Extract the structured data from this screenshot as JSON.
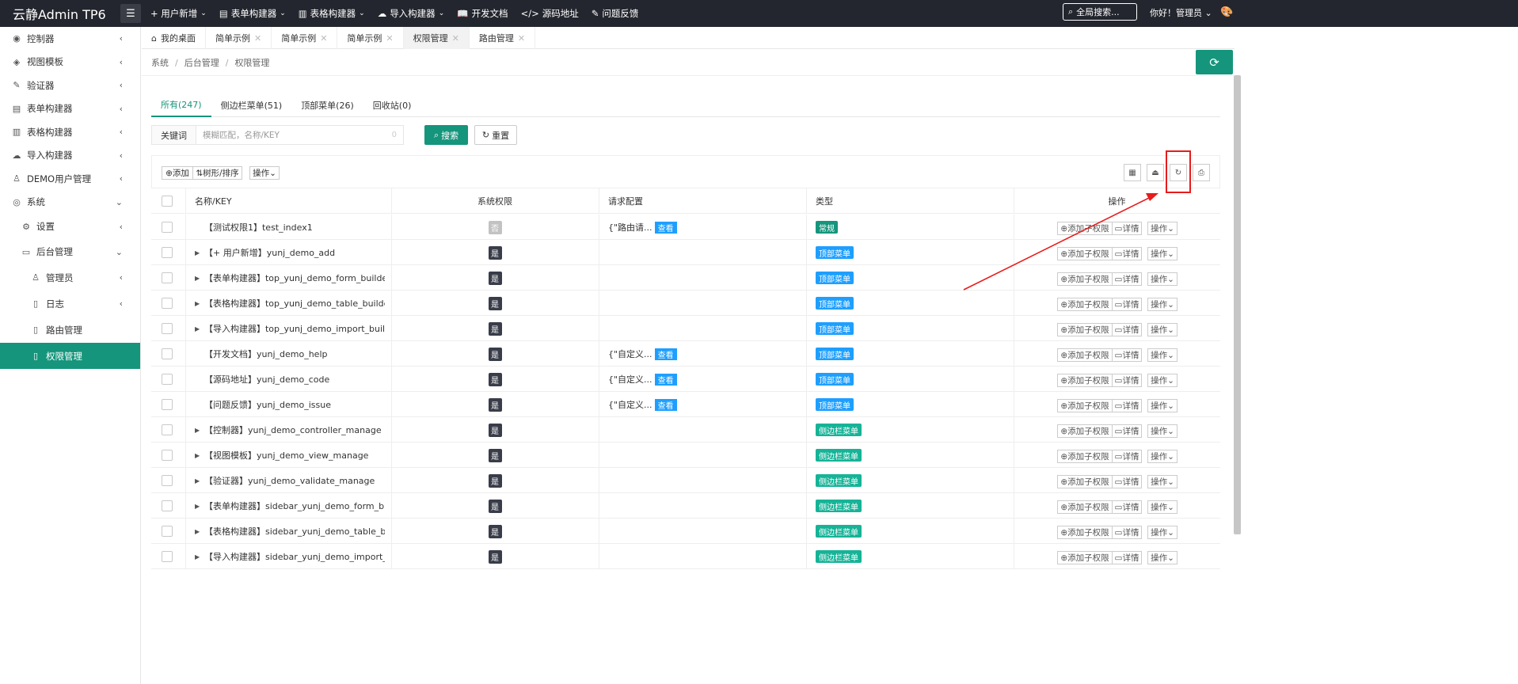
{
  "app": {
    "title": "云静Admin TP6"
  },
  "topnav": [
    {
      "label": "+ 用户新增",
      "icon": "",
      "dropdown": true
    },
    {
      "label": "表单构建器",
      "icon": "form-icon",
      "dropdown": true
    },
    {
      "label": "表格构建器",
      "icon": "table-icon",
      "dropdown": true
    },
    {
      "label": "导入构建器",
      "icon": "cloud-upload-icon",
      "dropdown": true
    },
    {
      "label": "开发文档",
      "icon": "book-icon",
      "dropdown": false
    },
    {
      "label": "源码地址",
      "icon": "code-icon",
      "dropdown": false
    },
    {
      "label": "问题反馈",
      "icon": "feedback-icon",
      "dropdown": false
    }
  ],
  "header": {
    "search_label": "全局搜索...",
    "user_label": "你好！管理员"
  },
  "sidebar": {
    "items": [
      {
        "label": "控制器",
        "icon": "dashboard-icon",
        "arrow": "‹"
      },
      {
        "label": "视图模板",
        "icon": "layers-icon",
        "arrow": "‹"
      },
      {
        "label": "验证器",
        "icon": "edit-icon",
        "arrow": "‹"
      },
      {
        "label": "表单构建器",
        "icon": "form-icon",
        "arrow": "‹"
      },
      {
        "label": "表格构建器",
        "icon": "table-icon",
        "arrow": "‹"
      },
      {
        "label": "导入构建器",
        "icon": "cloud-upload-icon",
        "arrow": "‹"
      },
      {
        "label": "DEMO用户管理",
        "icon": "user-icon",
        "arrow": "‹"
      },
      {
        "label": "系统",
        "icon": "system-icon",
        "arrow": "⌄"
      }
    ],
    "system_children": [
      {
        "label": "设置",
        "icon": "gear-icon",
        "arrow": "‹"
      },
      {
        "label": "后台管理",
        "icon": "admin-icon",
        "arrow": "⌄"
      }
    ],
    "admin_children": [
      {
        "label": "管理员",
        "icon": "user-icon",
        "arrow": "‹"
      },
      {
        "label": "日志",
        "icon": "file-icon",
        "arrow": "‹"
      },
      {
        "label": "路由管理",
        "icon": "file-icon",
        "arrow": ""
      },
      {
        "label": "权限管理",
        "icon": "file-icon",
        "arrow": ""
      }
    ]
  },
  "tabs": [
    {
      "label": "我的桌面",
      "home": true,
      "closable": false,
      "active": false
    },
    {
      "label": "简单示例",
      "closable": true,
      "active": false
    },
    {
      "label": "简单示例",
      "closable": true,
      "active": false
    },
    {
      "label": "简单示例",
      "closable": true,
      "active": false
    },
    {
      "label": "权限管理",
      "closable": true,
      "active": true
    },
    {
      "label": "路由管理",
      "closable": true,
      "active": false
    }
  ],
  "breadcrumb": [
    "系统",
    "后台管理",
    "权限管理"
  ],
  "breadcrumb_sep": "/",
  "subtabs": [
    {
      "label": "所有(247)",
      "active": true
    },
    {
      "label": "侧边栏菜单(51)",
      "active": false
    },
    {
      "label": "顶部菜单(26)",
      "active": false
    },
    {
      "label": "回收站(0)",
      "active": false
    }
  ],
  "search": {
    "label": "关键词",
    "placeholder": "模糊匹配，名称/KEY",
    "count": "0",
    "search_btn": "搜索",
    "reset_btn": "重置"
  },
  "toolbar": {
    "add": "添加",
    "tree_sort": "树形/排序",
    "ops": "操作"
  },
  "table": {
    "headers": [
      "名称/KEY",
      "系统权限",
      "请求配置",
      "类型",
      "操作"
    ],
    "action_add_child": "添加子权限",
    "action_detail": "详情",
    "action_ops": "操作",
    "view_label": "查看",
    "rows": [
      {
        "name": "【测试权限1】test_index1",
        "expand": false,
        "sys": "否",
        "req": "{\"路由请...",
        "view": true,
        "type": "常规",
        "type_kind": "normal"
      },
      {
        "name": "【+ 用户新增】yunj_demo_add",
        "expand": true,
        "sys": "是",
        "req": "",
        "view": false,
        "type": "顶部菜单",
        "type_kind": "top"
      },
      {
        "name": "【表单构建器】top_yunj_demo_form_builder_m...",
        "expand": true,
        "sys": "是",
        "req": "",
        "view": false,
        "type": "顶部菜单",
        "type_kind": "top"
      },
      {
        "name": "【表格构建器】top_yunj_demo_table_builder_m...",
        "expand": true,
        "sys": "是",
        "req": "",
        "view": false,
        "type": "顶部菜单",
        "type_kind": "top"
      },
      {
        "name": "【导入构建器】top_yunj_demo_import_builder_...",
        "expand": true,
        "sys": "是",
        "req": "",
        "view": false,
        "type": "顶部菜单",
        "type_kind": "top"
      },
      {
        "name": "【开发文档】yunj_demo_help",
        "expand": false,
        "sys": "是",
        "req": "{\"自定义...",
        "view": true,
        "type": "顶部菜单",
        "type_kind": "top"
      },
      {
        "name": "【源码地址】yunj_demo_code",
        "expand": false,
        "sys": "是",
        "req": "{\"自定义...",
        "view": true,
        "type": "顶部菜单",
        "type_kind": "top"
      },
      {
        "name": "【问题反馈】yunj_demo_issue",
        "expand": false,
        "sys": "是",
        "req": "{\"自定义...",
        "view": true,
        "type": "顶部菜单",
        "type_kind": "top"
      },
      {
        "name": "【控制器】yunj_demo_controller_manage",
        "expand": true,
        "sys": "是",
        "req": "",
        "view": false,
        "type": "侧边栏菜单",
        "type_kind": "side"
      },
      {
        "name": "【视图模板】yunj_demo_view_manage",
        "expand": true,
        "sys": "是",
        "req": "",
        "view": false,
        "type": "侧边栏菜单",
        "type_kind": "side"
      },
      {
        "name": "【验证器】yunj_demo_validate_manage",
        "expand": true,
        "sys": "是",
        "req": "",
        "view": false,
        "type": "侧边栏菜单",
        "type_kind": "side"
      },
      {
        "name": "【表单构建器】sidebar_yunj_demo_form_builde...",
        "expand": true,
        "sys": "是",
        "req": "",
        "view": false,
        "type": "侧边栏菜单",
        "type_kind": "side"
      },
      {
        "name": "【表格构建器】sidebar_yunj_demo_table_build...",
        "expand": true,
        "sys": "是",
        "req": "",
        "view": false,
        "type": "侧边栏菜单",
        "type_kind": "side"
      },
      {
        "name": "【导入构建器】sidebar_yunj_demo_import_buil...",
        "expand": true,
        "sys": "是",
        "req": "",
        "view": false,
        "type": "侧边栏菜单",
        "type_kind": "side"
      }
    ]
  },
  "colors": {
    "accent": "#15957c",
    "topbar": "#23262e",
    "top_badge": "#1e9fff",
    "side_badge": "#16b397",
    "annotation": "#e81c1c"
  }
}
